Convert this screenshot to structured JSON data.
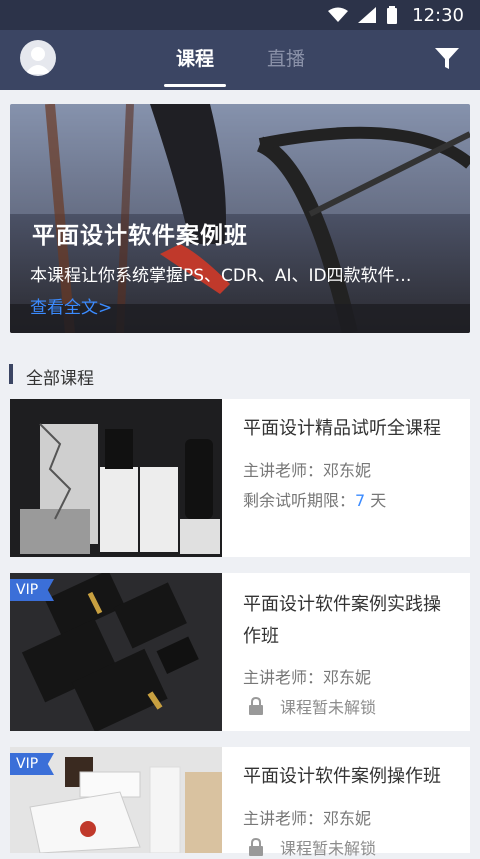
{
  "status_bar": {
    "time": "12:30"
  },
  "app_bar": {
    "tabs": [
      {
        "label": "课程",
        "active": true
      },
      {
        "label": "直播",
        "active": false
      }
    ]
  },
  "hero": {
    "title": "平面设计软件案例班",
    "description": "本课程让你系统掌握PS、CDR、AI、ID四款软件…",
    "link": "查看全文>"
  },
  "section": {
    "title": "全部课程"
  },
  "courses": [
    {
      "title": "平面设计精品试听全课程",
      "teacher": "主讲老师：邓东妮",
      "trial_prefix": "剩余试听期限：",
      "trial_days": "7",
      "trial_suffix": " 天",
      "vip": false
    },
    {
      "title_line1": "平面设计软件案例实践操",
      "title_line2": "作班",
      "teacher": "主讲老师：邓东妮",
      "status": "课程暂未解锁",
      "vip": true,
      "vip_label": "VIP"
    },
    {
      "title": "平面设计软件案例操作班",
      "teacher": "主讲老师：邓东妮",
      "status": "课程暂未解锁",
      "vip": true,
      "vip_label": "VIP"
    }
  ],
  "colors": {
    "status_bar": "#2c3349",
    "app_bar": "#3b4563",
    "accent_blue": "#3b8bff",
    "vip_badge": "#3b6fd8",
    "background": "#eef0f4"
  }
}
